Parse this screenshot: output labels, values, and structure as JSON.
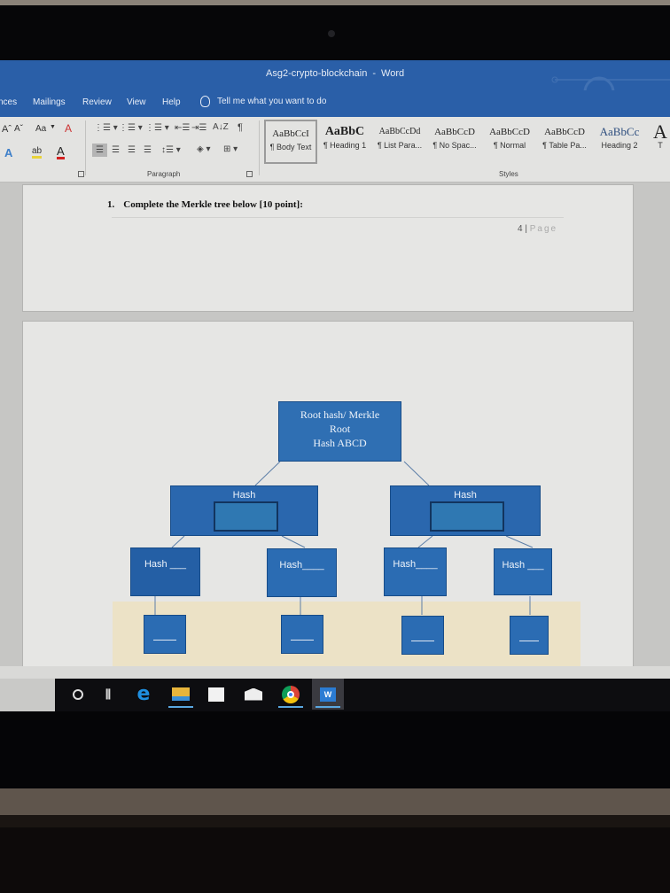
{
  "window": {
    "doc_name": "Asg2-crypto-blockchain",
    "separator": "-",
    "app_name": "Word"
  },
  "ribbon_tabs": [
    {
      "label": "nces"
    },
    {
      "label": "Mailings"
    },
    {
      "label": "Review"
    },
    {
      "label": "View"
    },
    {
      "label": "Help"
    }
  ],
  "tell_me": {
    "placeholder": "Tell me what you want to do"
  },
  "font_group": {
    "grow_font": "Aˆ",
    "shrink_font": "Aˇ",
    "change_case": "Aa",
    "text_effects": "A",
    "highlight": "ab",
    "font_color": "A"
  },
  "paragraph_group": {
    "label": "Paragraph",
    "sort": "A↓Z",
    "show_marks": "¶"
  },
  "styles_group": {
    "label": "Styles",
    "items": [
      {
        "sample": "AaBbCcI",
        "name": "¶ Body Text",
        "selected": true
      },
      {
        "sample": "AaBbC",
        "name": "¶ Heading 1",
        "selected": false
      },
      {
        "sample": "AaBbCcDd",
        "name": "¶ List Para...",
        "selected": false
      },
      {
        "sample": "AaBbCcD",
        "name": "¶ No Spac...",
        "selected": false
      },
      {
        "sample": "AaBbCcD",
        "name": "¶ Normal",
        "selected": false
      },
      {
        "sample": "AaBbCcD",
        "name": "¶ Table Pa...",
        "selected": false
      },
      {
        "sample": "AaBbCc",
        "name": "Heading 2",
        "selected": false
      },
      {
        "sample": "A",
        "name": "T",
        "selected": false
      }
    ]
  },
  "document": {
    "question_number": "1.",
    "question_text": "Complete the Merkle tree below [10 point]:",
    "page_number": "4",
    "page_sep": "|",
    "page_word": "Page",
    "diagram": {
      "root": {
        "line1": "Root hash/ Merkle",
        "line2": "Root",
        "line3": "Hash ABCD"
      },
      "level1": [
        {
          "label": "Hash"
        },
        {
          "label": "Hash"
        }
      ],
      "level2": [
        {
          "label": "Hash ___"
        },
        {
          "label": "Hash____"
        },
        {
          "label": "Hash____"
        },
        {
          "label": "Hash ___"
        }
      ],
      "leaves": [
        {
          "label": "______"
        },
        {
          "label": "______"
        },
        {
          "label": "______"
        },
        {
          "label": "______"
        }
      ]
    }
  },
  "taskbar": {
    "items": [
      {
        "name": "cortana-search",
        "glyph": "O",
        "running": false
      },
      {
        "name": "task-view",
        "glyph": "┃≡",
        "running": false
      },
      {
        "name": "edge",
        "glyph": "e",
        "running": false
      },
      {
        "name": "file-explorer",
        "glyph": "",
        "running": true
      },
      {
        "name": "store",
        "glyph": "",
        "running": false
      },
      {
        "name": "mail",
        "glyph": "",
        "running": false
      },
      {
        "name": "chrome",
        "glyph": "",
        "running": true
      },
      {
        "name": "word",
        "glyph": "W",
        "running": true
      }
    ]
  },
  "colors": {
    "title_bar": "#2a5fa8",
    "node_blue": "#2b6cb3",
    "leaf_band": "#ece2c6",
    "taskbar": "#0d0d10",
    "running_indicator": "#5aa7e0"
  }
}
